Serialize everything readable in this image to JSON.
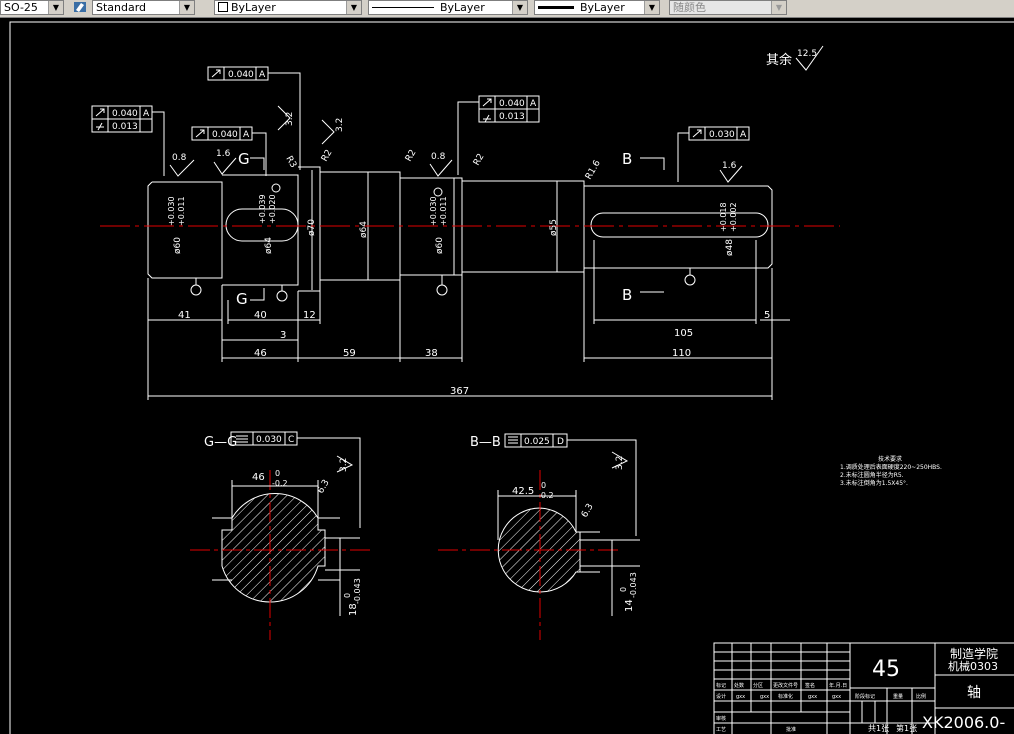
{
  "toolbar": {
    "dimstyle": "SO-25",
    "textstyle": "Standard",
    "layer_color": "ByLayer",
    "linetype": "ByLayer",
    "lineweight": "ByLayer",
    "plotstyle": "随颜色"
  },
  "drawing": {
    "roughness_note": "其余",
    "roughness_general": "12.5",
    "roughness_values": [
      "0.8",
      "1.6",
      "3.2",
      "3.2",
      "0.8",
      "1.6",
      "3.2",
      "3.2",
      "6.3",
      "6.3"
    ],
    "radii": [
      "R3",
      "R2",
      "R2",
      "R2",
      "R1.6"
    ],
    "datum_letters": [
      "A",
      "A",
      "A",
      "A"
    ],
    "tolerances": {
      "runout_left": "0.040",
      "cyl_left": "0.013",
      "runout_top": "0.040",
      "runout_mid": "0.040",
      "runout_top2": "0.040",
      "cyl_right": "0.013",
      "runout_right": "0.030",
      "sym_g": "0.030",
      "sym_b": "0.025"
    },
    "tol_datums": {
      "a": "A",
      "c": "C",
      "d": "D"
    },
    "diameters": {
      "d60_left": "ø60",
      "d60_left_tol_up": "+0.030",
      "d60_left_tol_lo": "+0.011",
      "d64_key": "ø64",
      "d64_key_tol_up": "+0.039",
      "d64_key_tol_lo": "+0.020",
      "d70": "ø70",
      "d64": "ø64",
      "d60_right": "ø60",
      "d60_right_tol_up": "+0.030",
      "d60_right_tol_lo": "+0.011",
      "d55": "ø55",
      "d48": "ø48",
      "d48_tol_up": "+0.018",
      "d48_tol_lo": "+0.002"
    },
    "section_marks": {
      "g_top": "G",
      "g_bot": "G",
      "b_top": "B",
      "b_bot": "B"
    },
    "dims": {
      "d41": "41",
      "d40": "40",
      "d3": "3",
      "d12": "12",
      "d46": "46",
      "d59": "59",
      "d38": "38",
      "d105": "105",
      "d5": "5",
      "d110": "110",
      "d367": "367"
    },
    "section_g": {
      "title": "G—G",
      "width": "46",
      "width_tol_up": "0",
      "width_tol_lo": "-0.2",
      "depth": "18",
      "depth_tol_up": "0",
      "depth_tol_lo": "-0.043"
    },
    "section_b": {
      "title": "B—B",
      "width": "42.5",
      "width_tol_up": "0",
      "width_tol_lo": "-0.2",
      "depth": "14",
      "depth_tol_up": "0",
      "depth_tol_lo": "-0.043"
    },
    "tech_req": {
      "title": "技术要求",
      "lines": [
        "1.调质处理后表面硬度220~250HBS.",
        "2.未标注圆角半径为R5.",
        "3.未标注倒角为1.5X45°."
      ]
    },
    "title_block": {
      "material": "45",
      "school": "制造学院",
      "class": "机械0303",
      "part": "轴",
      "drawing_no": "XK2006.0-",
      "row_labels": [
        "标记",
        "处数",
        "分区",
        "更改文件号",
        "签名",
        "年.月.日"
      ],
      "design_row": [
        "设计",
        "gxx",
        "gxx",
        "标准化",
        "gxx",
        "gxx"
      ],
      "stage_headers": [
        "阶段标记",
        "重量",
        "比例"
      ],
      "check_label": "审核",
      "process_label": "工艺",
      "approve_label": "批准",
      "sheet_total": "共1张",
      "sheet_no": "第1张"
    }
  }
}
